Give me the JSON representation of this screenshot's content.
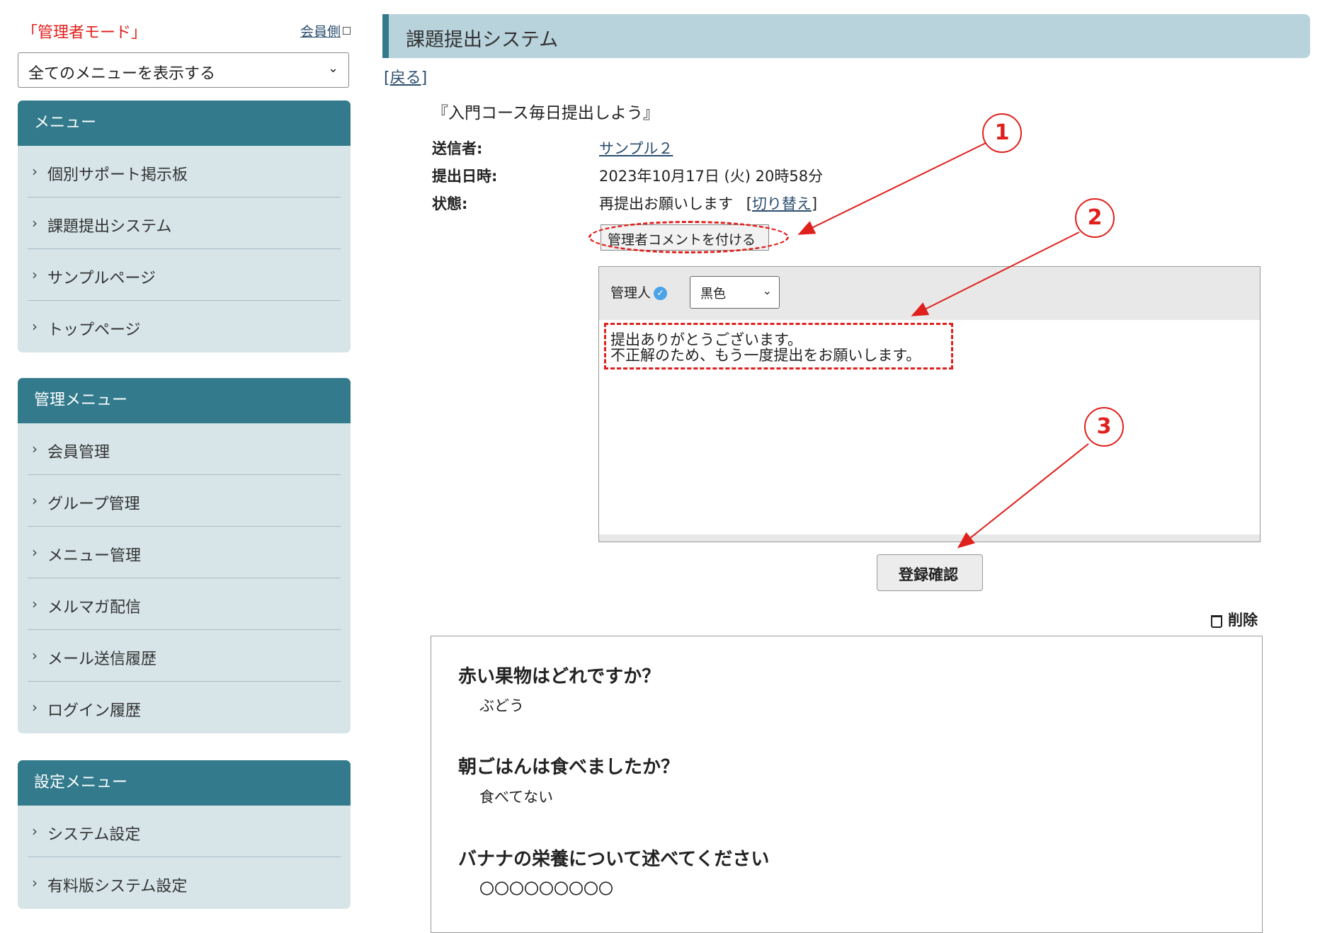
{
  "sidebar": {
    "mode_label": "「管理者モード」",
    "member_side_link": "会員側",
    "menu_select": "全てのメニューを表示する",
    "menus": [
      {
        "header": "メニュー",
        "items": [
          "個別サポート掲示板",
          "課題提出システム",
          "サンプルページ",
          "トップページ"
        ]
      },
      {
        "header": "管理メニュー",
        "items": [
          "会員管理",
          "グループ管理",
          "メニュー管理",
          "メルマガ配信",
          "メール送信履歴",
          "ログイン履歴"
        ]
      },
      {
        "header": "設定メニュー",
        "items": [
          "システム設定",
          "有料版システム設定"
        ]
      }
    ]
  },
  "main": {
    "page_title": "課題提出システム",
    "back_link": "戻る",
    "course_title": "『入門コース毎日提出しよう』",
    "info": {
      "sender_label": "送信者:",
      "sender_value": "サンプル２",
      "date_label": "提出日時:",
      "date_value": "2023年10月17日 (火) 20時58分",
      "status_label": "状態:",
      "status_value": "再提出お願いします",
      "toggle_link": "切り替え"
    },
    "comment_button": "管理者コメントを付ける",
    "editor": {
      "author": "管理人",
      "color_select": "黒色",
      "text_lines": [
        "提出ありがとうございます。",
        "不正解のため、もう一度提出をお願いします。"
      ]
    },
    "confirm_button": "登録確認",
    "delete_button": "削除",
    "qa": [
      {
        "question": "赤い果物はどれですか？",
        "answer": "ぶどう"
      },
      {
        "question": "朝ごはんは食べましたか？",
        "answer": "食べてない"
      },
      {
        "question": "バナナの栄養について述べてください",
        "answer": "〇〇〇〇〇〇〇〇〇"
      }
    ]
  },
  "annotations": {
    "markers": [
      "1",
      "2",
      "3"
    ],
    "color": "#e0201c"
  },
  "colors": {
    "menu_header": "#327a8c",
    "menu_body": "#d7e5e9",
    "title_bar": "#b8d3dc",
    "mode_label": "#e0201c"
  }
}
